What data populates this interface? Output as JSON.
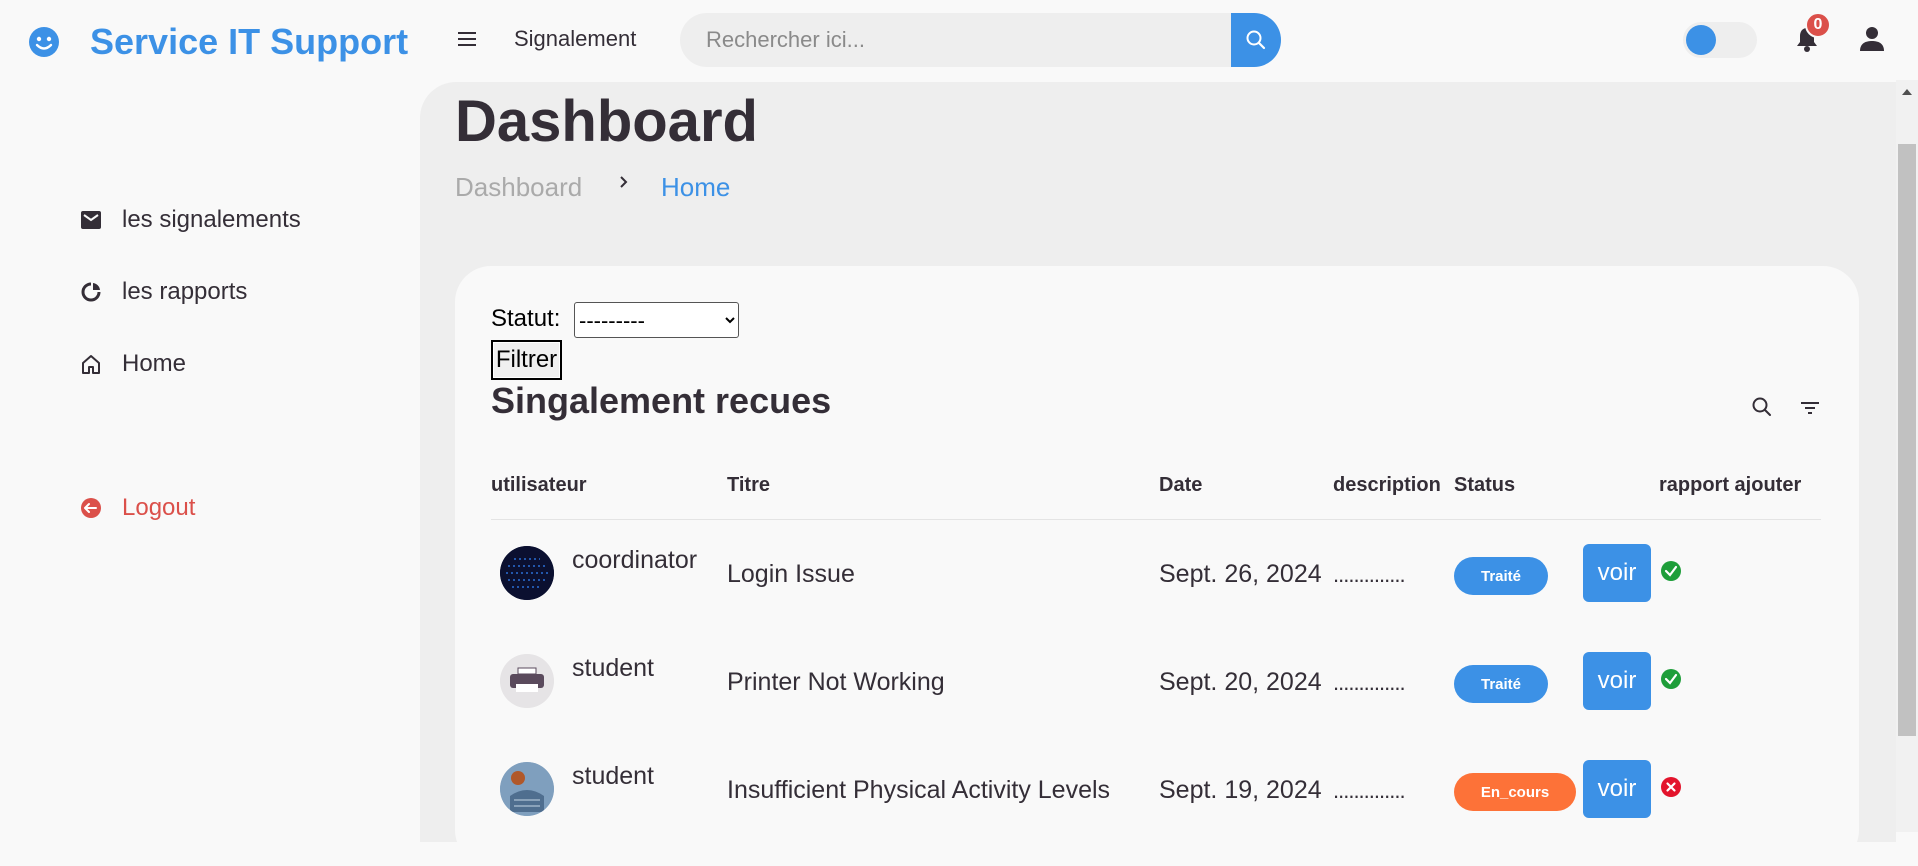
{
  "brand": {
    "title": "Service IT Support"
  },
  "topnav": {
    "link": "Signalement",
    "search_placeholder": "Rechercher ici...",
    "notification_count": "0"
  },
  "sidebar": {
    "items": [
      {
        "label": "les signalements",
        "icon": "mail-icon"
      },
      {
        "label": "les rapports",
        "icon": "pie-chart-icon"
      },
      {
        "label": "Home",
        "icon": "home-icon"
      }
    ],
    "logout": "Logout"
  },
  "main": {
    "title": "Dashboard",
    "breadcrumb": [
      "Dashboard",
      "Home"
    ]
  },
  "filter": {
    "label": "Statut:",
    "selected": "---------",
    "button": "Filtrer"
  },
  "table": {
    "title": "Singalement recues",
    "columns": [
      "utilisateur",
      "Titre",
      "Date",
      "description",
      "Status",
      "rapport ajouter"
    ],
    "rows": [
      {
        "user": "coordinator",
        "title": "Login Issue",
        "date": "Sept. 26, 2024",
        "description": "..............",
        "status": "Traité",
        "action": "voir",
        "report": "check-icon"
      },
      {
        "user": "student",
        "title": "Printer Not Working",
        "date": "Sept. 20, 2024",
        "description": "..............",
        "status": "Traité",
        "action": "voir",
        "report": "check-icon"
      },
      {
        "user": "student",
        "title": "Insufficient Physical Activity Levels",
        "date": "Sept. 19, 2024",
        "description": "..............",
        "status": "En_cours",
        "action": "voir",
        "report": "cross-icon"
      }
    ]
  },
  "colors": {
    "accent": "#3c91e6",
    "danger": "#db504a",
    "pending": "#fd7238",
    "success": "#1e9e3a"
  }
}
